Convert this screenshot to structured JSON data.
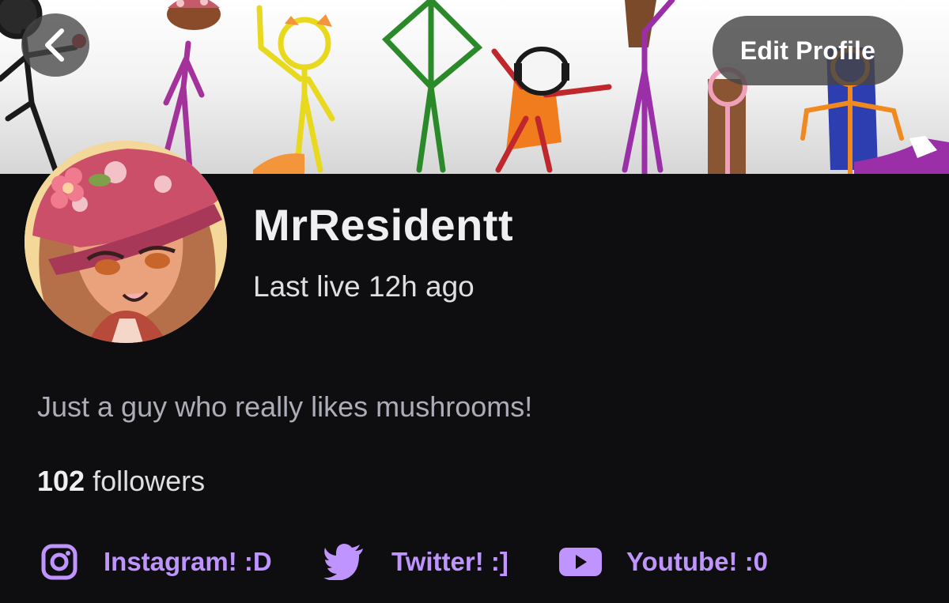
{
  "profile": {
    "username": "MrResidentt",
    "last_live": "Last live 12h ago",
    "bio": "Just a guy who really likes mushrooms!",
    "followers_count": "102",
    "followers_label": " followers"
  },
  "header": {
    "edit_profile_label": "Edit Profile"
  },
  "social_links": [
    {
      "label": "Instagram! :D",
      "icon": "instagram-icon"
    },
    {
      "label": "Twitter! :]",
      "icon": "twitter-icon"
    },
    {
      "label": "Youtube! :0",
      "icon": "youtube-icon"
    }
  ],
  "colors": {
    "background": "#0e0e10",
    "accent": "#bf94ff",
    "button_bg": "#464646"
  }
}
